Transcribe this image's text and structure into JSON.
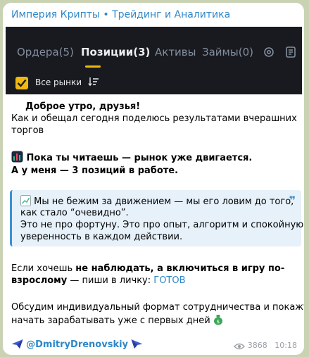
{
  "channel": {
    "title": "Империя Крипты • Трейдинг и Аналитика"
  },
  "tabs": [
    {
      "label": "Ордера(5)"
    },
    {
      "label": "Позиции(3)"
    },
    {
      "label": "Активы"
    },
    {
      "label": "Займы(0)"
    }
  ],
  "panel": {
    "markets_label": "Все рынки",
    "accent": "#f0b90b",
    "bg": "#181a20"
  },
  "message": {
    "greeting": "Доброе утро, друзья!",
    "intro_line1": "Как и обещал сегодня поделюсь результатами вчерашних",
    "intro_line2": "торгов",
    "market_line": "Пока ты читаешь — рынок уже двигается.",
    "positions_line": "А у меня — 3 позиций в работе.",
    "quote_line1": "Мы не бежим за движением — мы его ловим до того,",
    "quote_line2": "как стало “очевидно”.",
    "quote_line3": "Это не про фортуну. Это про опыт, алгоритм и спокойную",
    "quote_line4": "уверенность в каждом действии.",
    "cta_prefix": "Если хочешь ",
    "cta_bold1": "не наблюдать, а включиться в игру по-",
    "cta_bold2": "взрослому",
    "cta_mid": " — пиши в личку: ",
    "cta_link": "ГОТОВ",
    "discuss_line1": "Обсудим индивидуальный формат сотрудничества и покажу, как",
    "discuss_line2": "начать зарабатывать уже с первых дней",
    "username": "@DmitryDrenovskiy"
  },
  "footer": {
    "views": "3868",
    "time": "10:18"
  }
}
